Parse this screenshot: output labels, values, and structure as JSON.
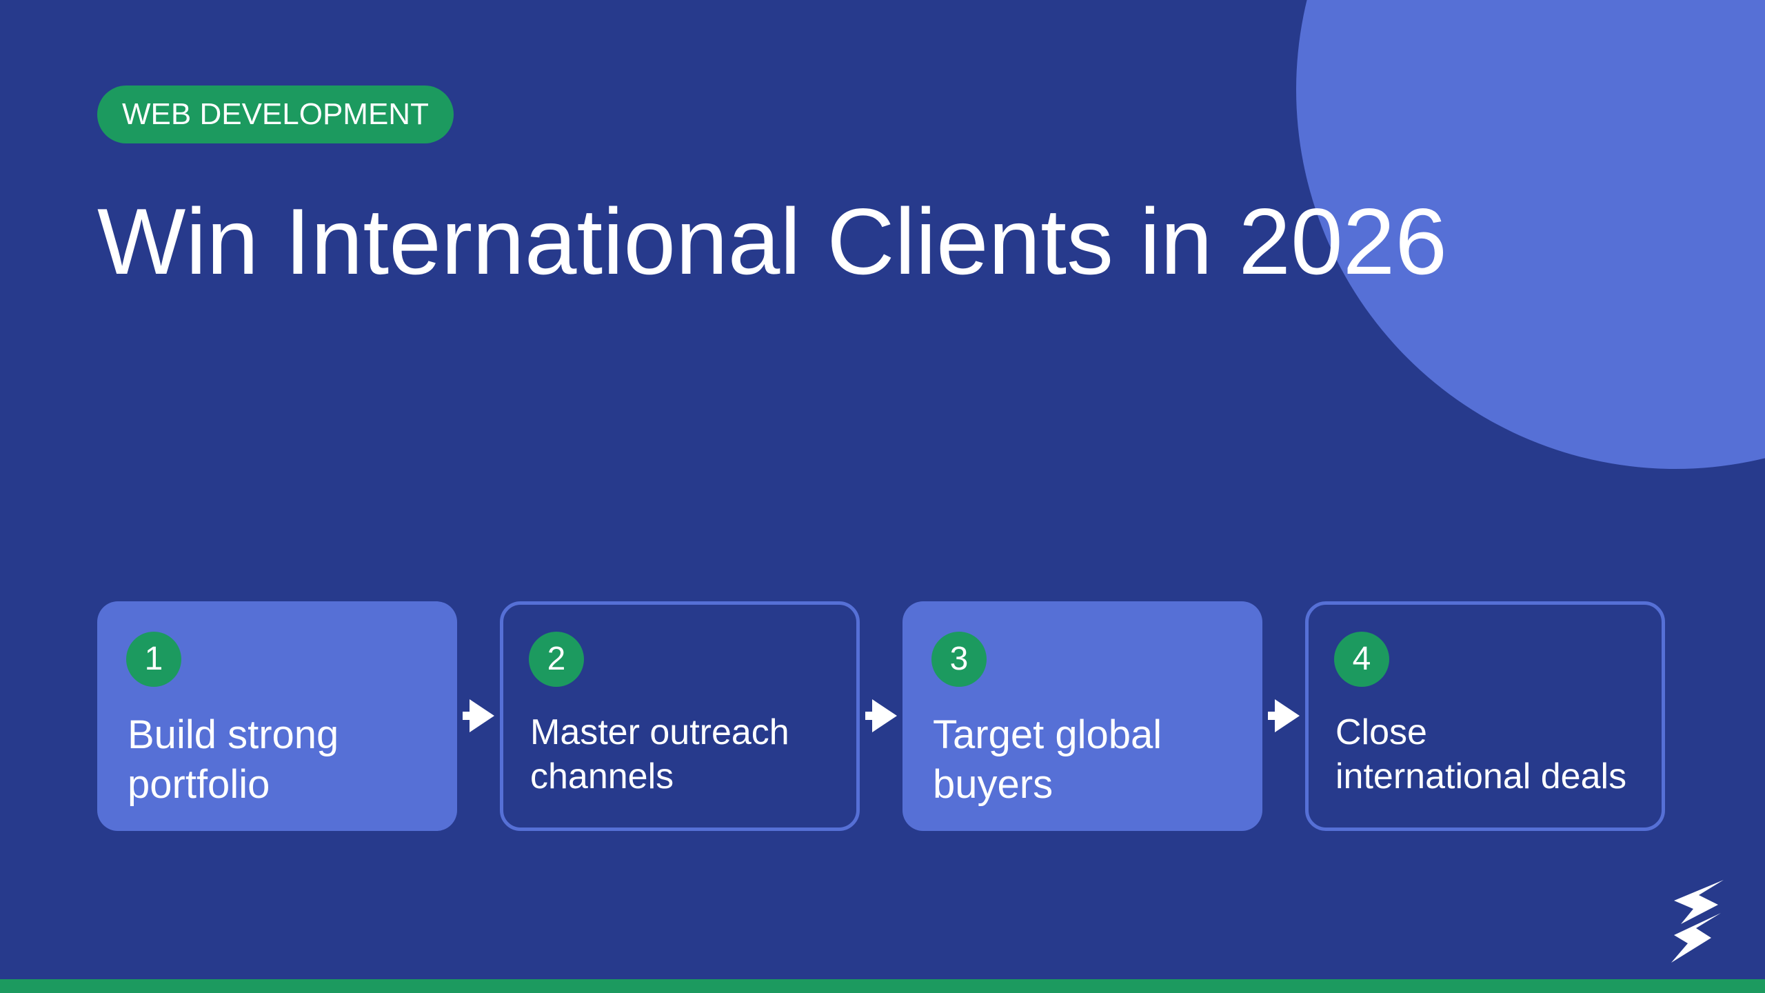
{
  "slide": {
    "tag": "WEB DEVELOPMENT",
    "title": "Win International Clients in 2026"
  },
  "steps": [
    {
      "number": "1",
      "label": "Build strong\nportfolio",
      "style": "filled"
    },
    {
      "number": "2",
      "label": "Master outreach\nchannels",
      "style": "outlined"
    },
    {
      "number": "3",
      "label": "Target global\nbuyers",
      "style": "filled"
    },
    {
      "number": "4",
      "label": "Close\ninternational deals",
      "style": "outlined"
    }
  ],
  "icons": {
    "arrow": "arrow-right-icon",
    "logo": "lightning-logo-icon"
  },
  "colors": {
    "background": "#273a8c",
    "accent_blue": "#5670d6",
    "accent_green": "#1c9a5f",
    "text": "#ffffff"
  }
}
